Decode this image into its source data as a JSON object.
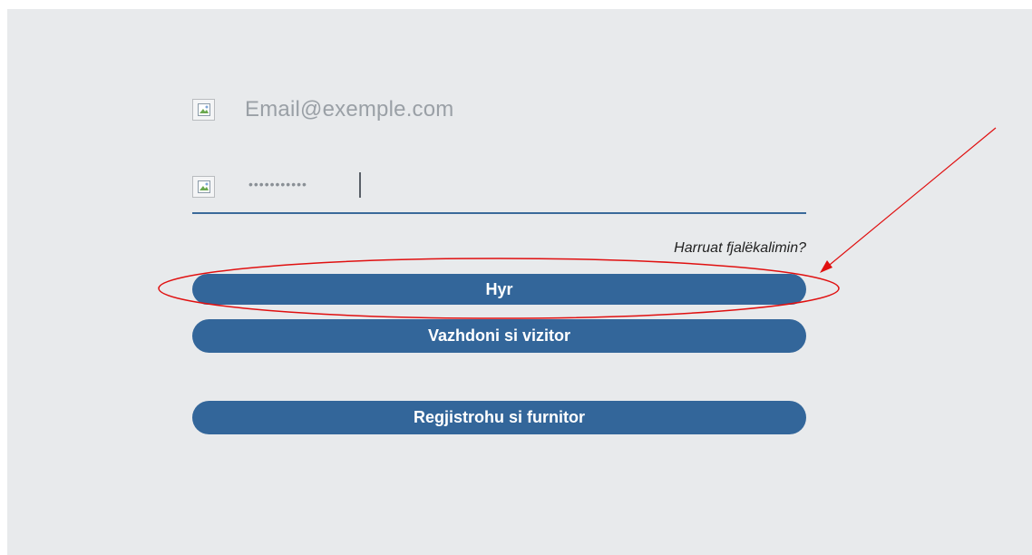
{
  "login_form": {
    "email_placeholder": "Email@exemple.com",
    "email_icon": "broken-image-icon",
    "password_mask": "•••••••••••",
    "password_icon": "broken-image-icon",
    "forgot_password_label": "Harruat fjalëkalimin?",
    "login_button_label": "Hyr",
    "visitor_button_label": "Vazhdoni si vizitor",
    "register_supplier_button_label": "Regjistrohu si furnitor"
  },
  "annotation": {
    "highlight_color": "#e01010",
    "highlight_target": "login-button"
  },
  "theme": {
    "background": "#e8eaec",
    "button_color": "#33669a",
    "input_underline": "#3a6a9a"
  }
}
